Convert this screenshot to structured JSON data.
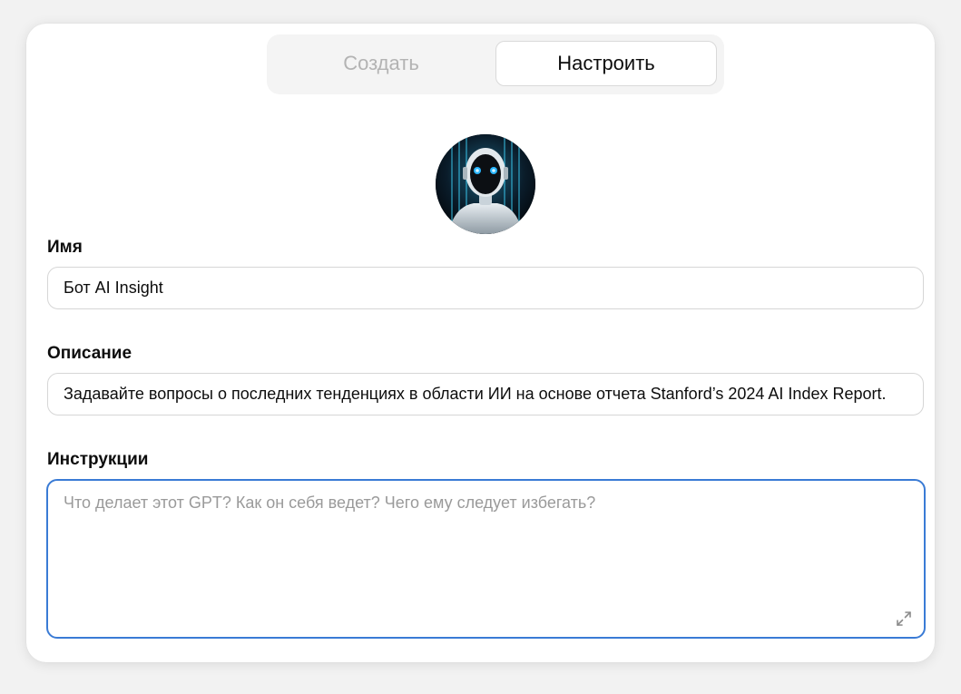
{
  "tabs": {
    "create_label": "Создать",
    "configure_label": "Настроить",
    "active": "configure"
  },
  "avatar": {
    "icon": "robot-avatar"
  },
  "fields": {
    "name": {
      "label": "Имя",
      "value": "Бот AI Insight"
    },
    "description": {
      "label": "Описание",
      "value": "Задавайте вопросы о последних тенденциях в области ИИ на основе отчета Stanford’s 2024 AI Index Report."
    },
    "instructions": {
      "label": "Инструкции",
      "value": "",
      "placeholder": "Что делает этот GPT? Как он себя ведет? Чего ему следует избегать?"
    }
  },
  "colors": {
    "accent_focus": "#3a7bd5",
    "inactive_tab_text": "#b3b3b3",
    "placeholder_text": "#9a9a9a"
  },
  "icons": {
    "expand": "expand-icon"
  }
}
